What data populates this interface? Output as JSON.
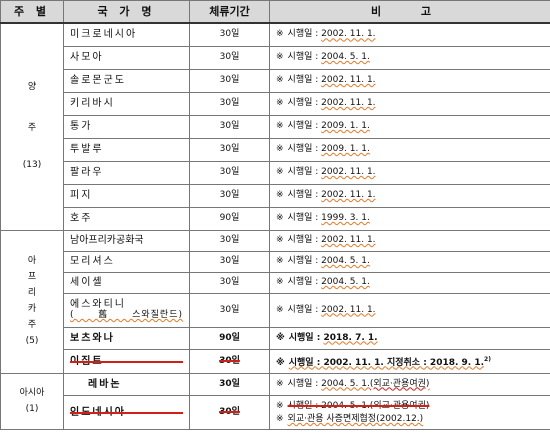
{
  "headers": {
    "region": "주 별",
    "country": "국 가 명",
    "period": "체류기간",
    "note": "비 고"
  },
  "regions": {
    "oceania": {
      "chars": [
        "양",
        "주",
        "(13)"
      ]
    },
    "africa": {
      "chars": [
        "아",
        "프",
        "리",
        "카",
        "주",
        "(5)"
      ]
    },
    "asia": {
      "chars": [
        "아시아",
        "(1)"
      ]
    }
  },
  "rows": [
    {
      "country": "미크로네시아",
      "period": "30일",
      "mark": "※",
      "note_label": "시행일 : ",
      "note_date": "2002. 11. 1."
    },
    {
      "country": "사모아",
      "period": "30일",
      "mark": "※",
      "note_label": "시행일 : ",
      "note_date": "2004. 5. 1."
    },
    {
      "country": "솔로몬군도",
      "period": "30일",
      "mark": "※",
      "note_label": "시행일 : ",
      "note_date": "2002. 11. 1."
    },
    {
      "country": "키리바시",
      "period": "30일",
      "mark": "※",
      "note_label": "시행일 : ",
      "note_date": "2002. 11. 1."
    },
    {
      "country": "통가",
      "period": "30일",
      "mark": "※",
      "note_label": "시행일 : ",
      "note_date": "2009. 1. 1."
    },
    {
      "country": "투발루",
      "period": "30일",
      "mark": "※",
      "note_label": "시행일 : ",
      "note_date": "2009. 1. 1."
    },
    {
      "country": "팔라우",
      "period": "30일",
      "mark": "※",
      "note_label": "시행일 : ",
      "note_date": "2002. 11. 1."
    },
    {
      "country": "피지",
      "period": "30일",
      "mark": "※",
      "note_label": "시행일 : ",
      "note_date": "2002. 11. 1."
    },
    {
      "country": "호주",
      "period": "90일",
      "mark": "※",
      "note_label": "시행일 : ",
      "note_date": "1999. 3. 1."
    },
    {
      "country": "남아프리카공화국",
      "period": "30일",
      "mark": "※",
      "note_label": "시행일 : ",
      "note_date": "2002. 11. 1."
    },
    {
      "country": "모리셔스",
      "period": "30일",
      "mark": "※",
      "note_label": "시행일 : ",
      "note_date": "2004. 5. 1."
    },
    {
      "country": "세이셸",
      "period": "30일",
      "mark": "※",
      "note_label": "시행일 : ",
      "note_date": "2004. 5. 1."
    },
    {
      "country": "에스와티니",
      "country_sub": "(舊스와질란드)",
      "period": "30일",
      "mark": "※",
      "note_label": "시행일 : ",
      "note_date": "2002. 11. 1."
    },
    {
      "country": "보츠와나",
      "period": "90일",
      "mark": "※",
      "note_label": "시행일 : ",
      "note_date": "2018. 7. 1."
    },
    {
      "country": "이집트",
      "period": "30일",
      "mark": "※",
      "note_label": "시행일 : 2002. 11. 1. 지정취소 : 2018. 9. 1.",
      "note_sup": "2)"
    },
    {
      "country": "레바논",
      "period": "30일",
      "mark": "※",
      "note_label": "시행일 : ",
      "note_date": "2004. 5. 1.",
      "note_extra": "(외교·관용여권)"
    },
    {
      "country": "인도네시아",
      "period": "30일",
      "mark": "※",
      "note_label": "시행일 : 2004. 5. 1.(외교·관용여권)",
      "mark2": "※",
      "note_line2": "외교·관용 사증면제협정(2002.12.)"
    }
  ]
}
